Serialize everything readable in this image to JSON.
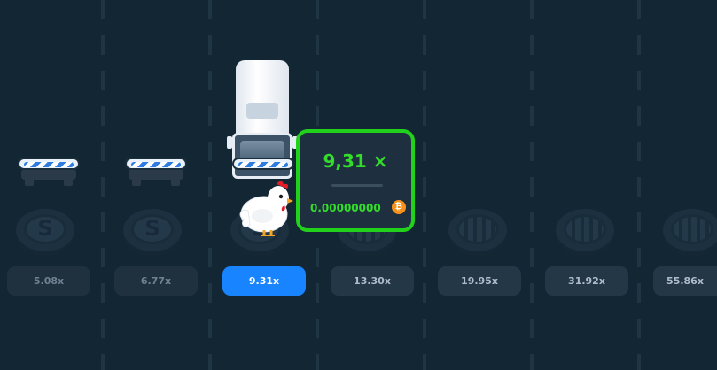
{
  "game": {
    "lanes": [
      {
        "multiplier": "5.08x",
        "state": "passed",
        "cover": "S"
      },
      {
        "multiplier": "6.77x",
        "state": "passed",
        "cover": "S"
      },
      {
        "multiplier": "9.31x",
        "state": "current",
        "cover": "S"
      },
      {
        "multiplier": "13.30x",
        "state": "upcoming",
        "cover": "grid"
      },
      {
        "multiplier": "19.95x",
        "state": "upcoming",
        "cover": "grid"
      },
      {
        "multiplier": "31.92x",
        "state": "upcoming",
        "cover": "grid"
      },
      {
        "multiplier": "55.86x",
        "state": "upcoming",
        "cover": "grid"
      }
    ],
    "popup": {
      "multiplier": "9,31 ×",
      "amount": "0.00000000",
      "currency_icon": "bitcoin-icon",
      "coin_symbol": "₿"
    },
    "manhole_symbol": "S",
    "colors": {
      "active": "#1884ff",
      "win_green": "#21d11b",
      "background": "#132634"
    }
  }
}
